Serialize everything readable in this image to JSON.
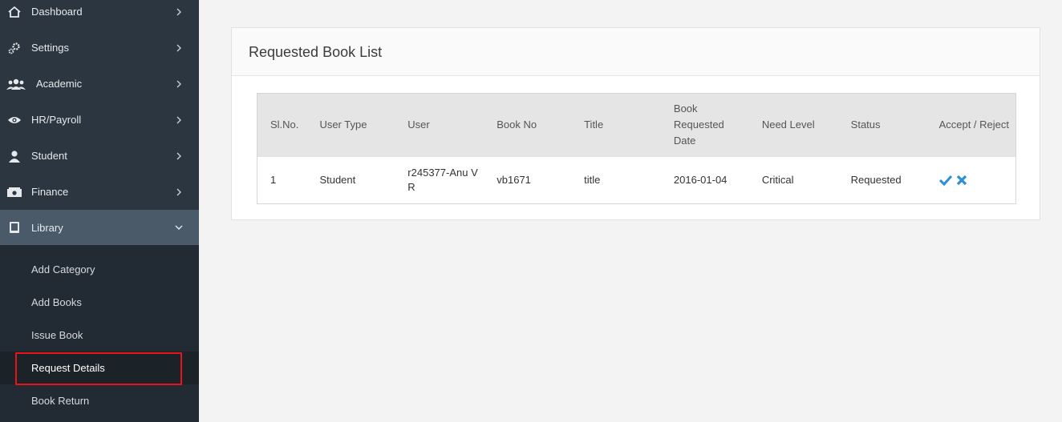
{
  "sidebar": {
    "items": [
      {
        "label": "Dashboard",
        "icon": "home-icon"
      },
      {
        "label": "Settings",
        "icon": "gears-icon"
      },
      {
        "label": "Academic",
        "icon": "users-icon"
      },
      {
        "label": "HR/Payroll",
        "icon": "eye-icon"
      },
      {
        "label": "Student",
        "icon": "user-icon"
      },
      {
        "label": "Finance",
        "icon": "money-icon"
      },
      {
        "label": "Library",
        "icon": "book-icon"
      }
    ],
    "library_submenu": [
      {
        "label": "Add Category"
      },
      {
        "label": "Add Books"
      },
      {
        "label": "Issue Book"
      },
      {
        "label": "Request Details"
      },
      {
        "label": "Book Return"
      }
    ],
    "active_submenu": "Request Details"
  },
  "main": {
    "panel_title": "Requested Book List",
    "table": {
      "headers": [
        "Sl.No.",
        "User Type",
        "User",
        "Book No",
        "Title",
        "Book Requested Date",
        "Need Level",
        "Status",
        "Accept / Reject"
      ],
      "rows": [
        {
          "sl": "1",
          "user_type": "Student",
          "user": "r245377-Anu V R",
          "book_no": "vb1671",
          "title": "title",
          "date": "2016-01-04",
          "need_level": "Critical",
          "status": "Requested"
        }
      ]
    }
  },
  "colors": {
    "sidebar_bg": "#2b3640",
    "open_item_bg": "#4a5a68",
    "highlight": "#e8141a",
    "action_blue": "#2b8fd6"
  }
}
